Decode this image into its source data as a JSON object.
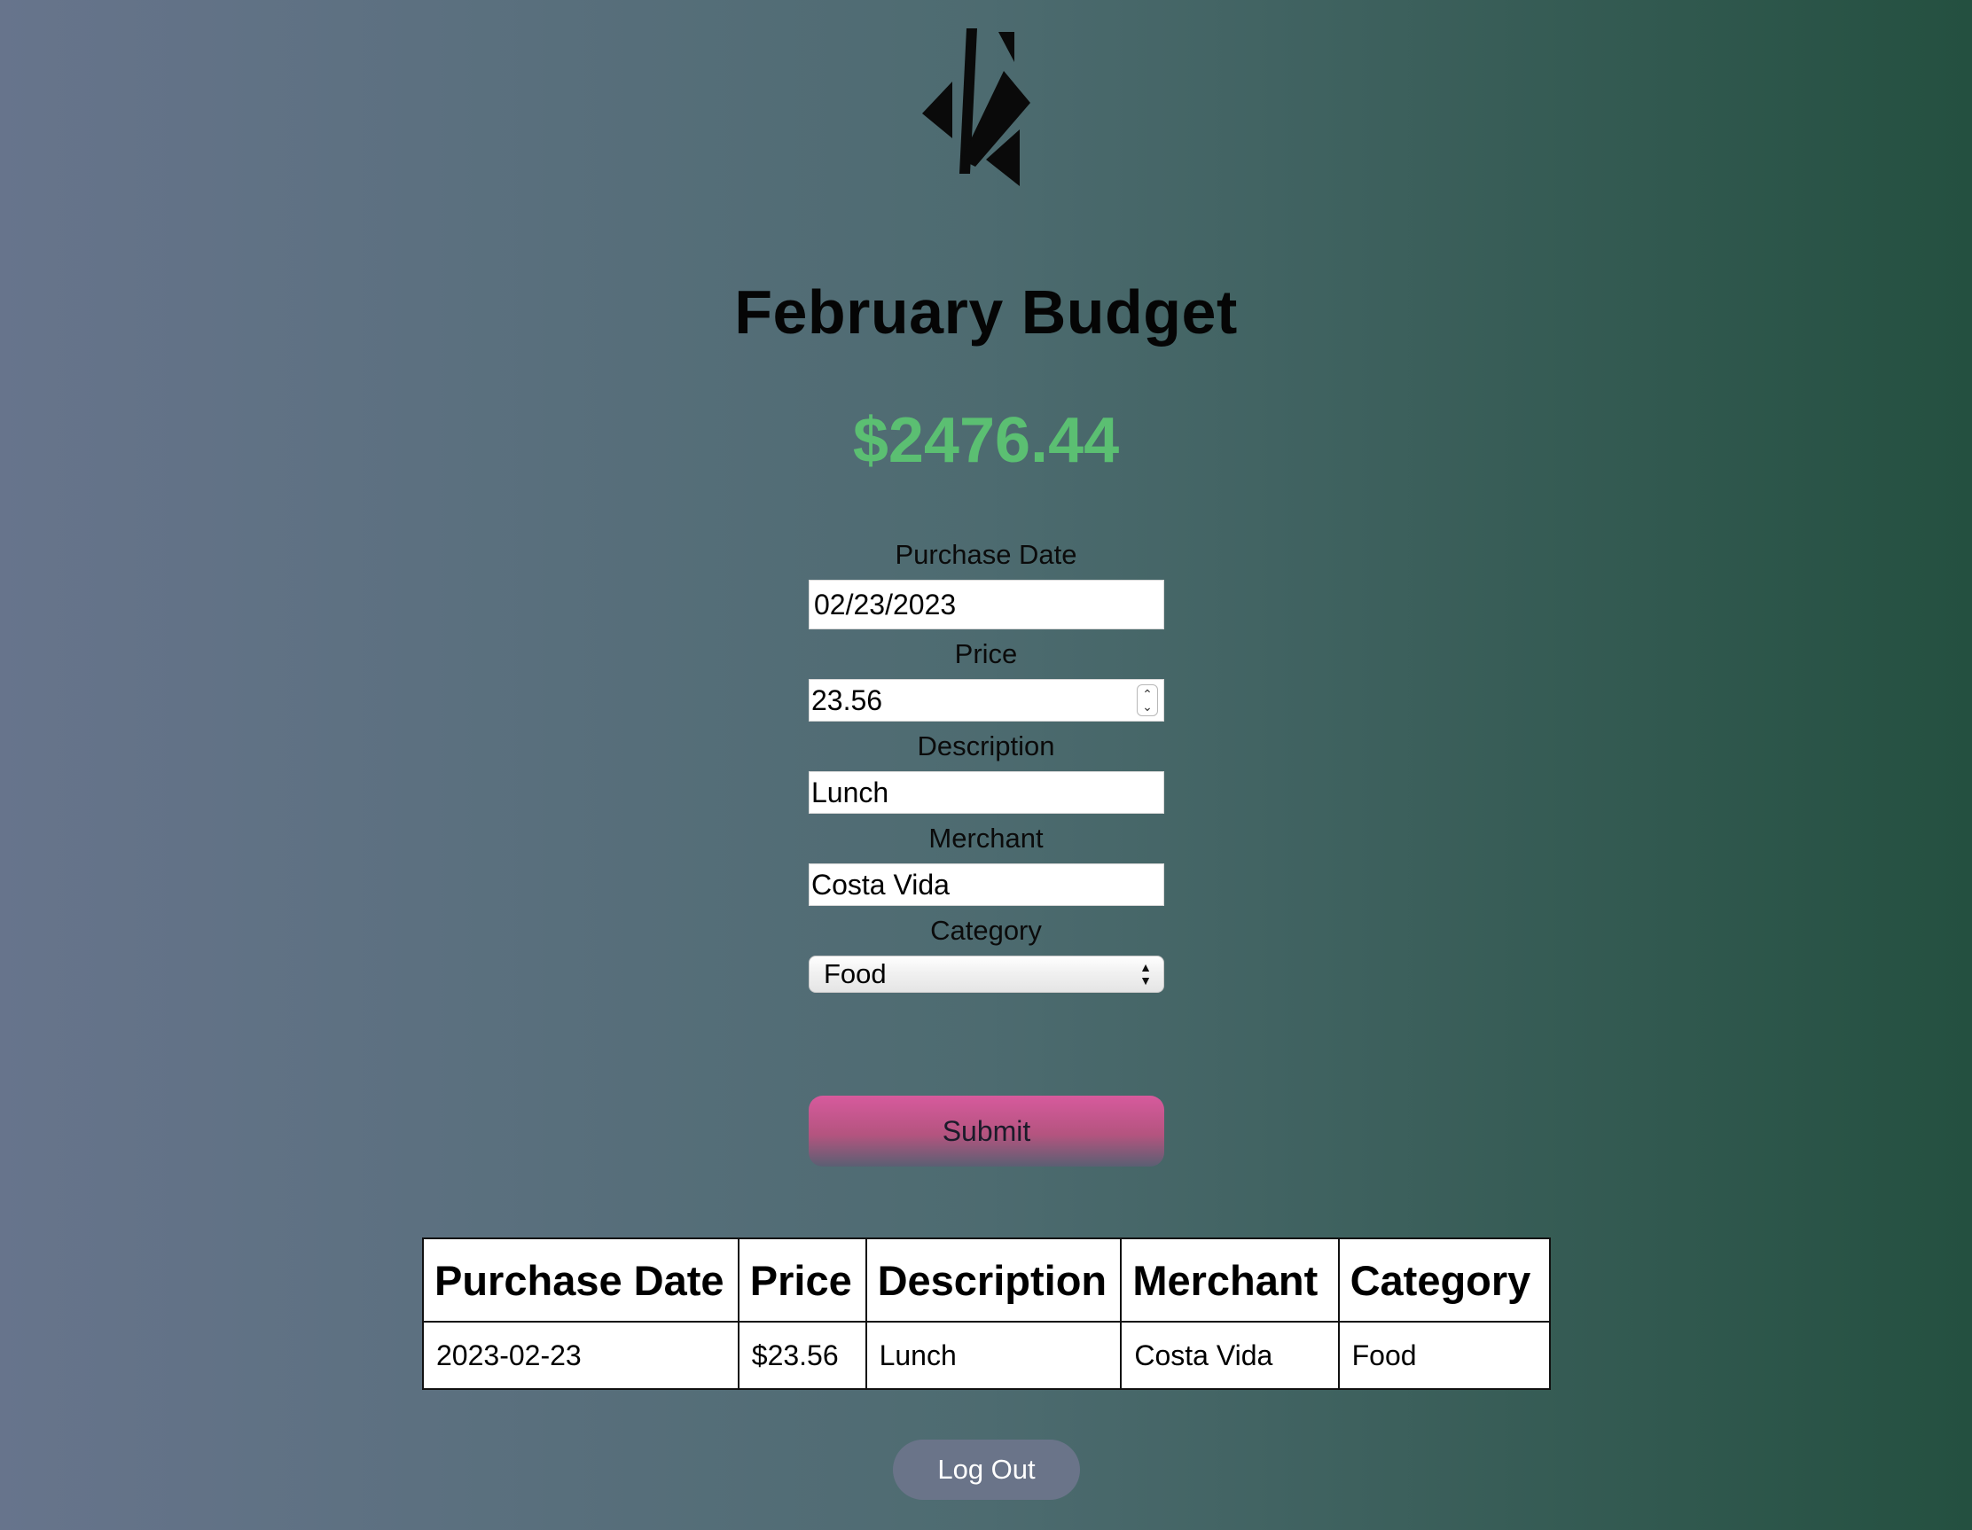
{
  "header": {
    "logo_icon": "geometric-triangles-logo",
    "title": "February Budget",
    "remaining_amount": "$2476.44",
    "amount_color": "#5bbf72"
  },
  "form": {
    "purchase_date": {
      "label": "Purchase Date",
      "value": "02/23/2023"
    },
    "price": {
      "label": "Price",
      "value": "23.56"
    },
    "description": {
      "label": "Description",
      "value": "Lunch"
    },
    "merchant": {
      "label": "Merchant",
      "value": "Costa Vida"
    },
    "category": {
      "label": "Category",
      "value": "Food"
    },
    "submit_label": "Submit"
  },
  "table": {
    "headers": [
      "Purchase Date",
      "Price",
      "Description",
      "Merchant",
      "Category"
    ],
    "rows": [
      [
        "2023-02-23",
        "$23.56",
        "Lunch",
        "Costa Vida",
        "Food"
      ]
    ]
  },
  "logout_label": "Log Out"
}
